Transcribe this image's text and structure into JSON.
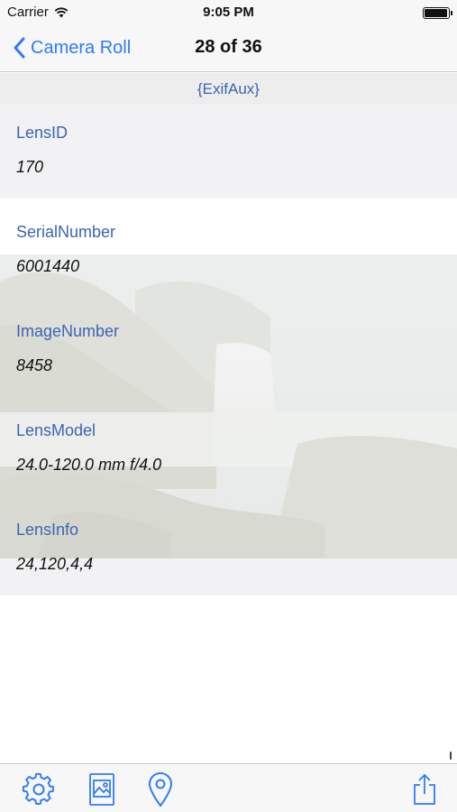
{
  "status_bar": {
    "carrier": "Carrier",
    "time": "9:05 PM",
    "battery_level": 1.0
  },
  "nav": {
    "back_label": "Camera Roll",
    "title": "28 of 36"
  },
  "section": {
    "title": "{ExifAux}"
  },
  "rows": [
    {
      "key": "LensID",
      "value": "170"
    },
    {
      "key": "SerialNumber",
      "value": "6001440"
    },
    {
      "key": "ImageNumber",
      "value": "8458"
    },
    {
      "key": "LensModel",
      "value": "24.0-120.0 mm f/4.0"
    },
    {
      "key": "LensInfo",
      "value": "24,120,4,4"
    }
  ],
  "toolbar": {
    "icons": [
      "settings-gear-icon",
      "photo-icon",
      "location-pin-icon",
      "share-icon"
    ]
  },
  "colors": {
    "accent": "#2f7cf6",
    "key_text": "#3c64b4",
    "section_bg": "#ededee"
  }
}
